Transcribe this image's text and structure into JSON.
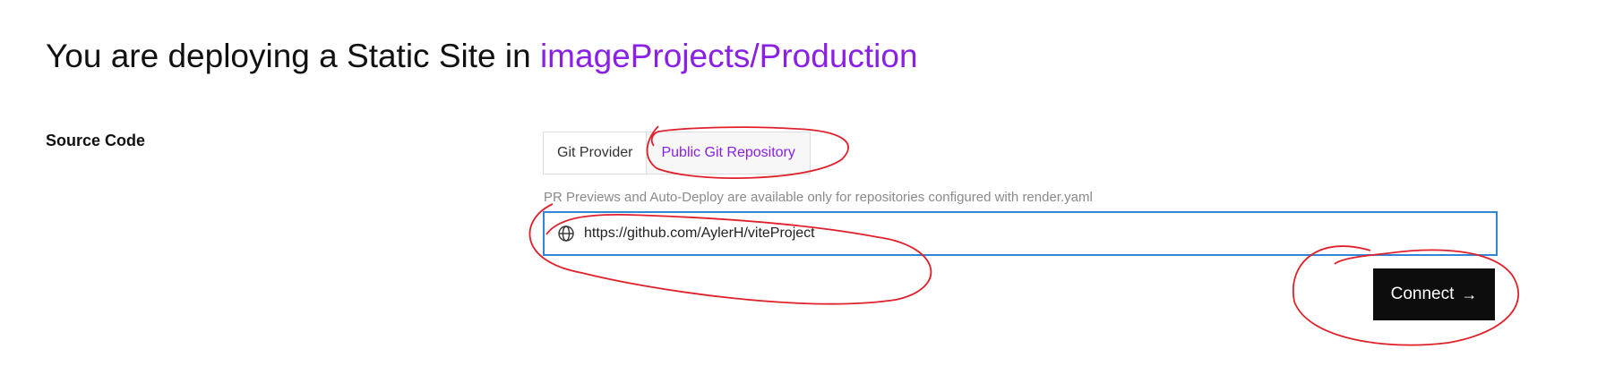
{
  "header": {
    "title_prefix": "You are deploying a Static Site in ",
    "project_path": "imageProjects/Production"
  },
  "source_code": {
    "label": "Source Code",
    "tabs": [
      {
        "label": "Git Provider",
        "active": false
      },
      {
        "label": "Public Git Repository",
        "active": true
      }
    ],
    "hint": "PR Previews and Auto-Deploy are available only for repositories configured with render.yaml",
    "repo_url": {
      "value": "https://github.com/AylerH/viteProject",
      "icon": "globe-icon"
    },
    "connect": {
      "label": "Connect",
      "icon": "arrow-right-icon",
      "icon_glyph": "→"
    }
  },
  "colors": {
    "accent": "#8a1fe6",
    "focus_border": "#2f86d6",
    "button_bg": "#0d0d0d",
    "annotation": "#e0202a"
  }
}
